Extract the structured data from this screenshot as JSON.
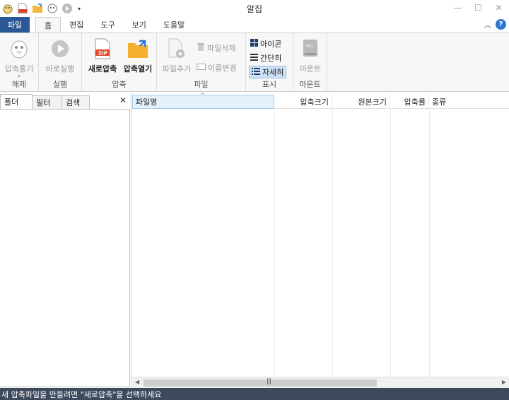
{
  "window": {
    "title": "알집"
  },
  "quick_access": [
    "app-logo-icon",
    "zip-icon",
    "folder-open-icon",
    "extract-icon",
    "play-icon",
    "dropdown-icon"
  ],
  "tabs": [
    {
      "label": "파일"
    },
    {
      "label": "홈"
    },
    {
      "label": "편집"
    },
    {
      "label": "도구"
    },
    {
      "label": "보기"
    },
    {
      "label": "도움말"
    }
  ],
  "ribbon": {
    "extract": {
      "label": "압축풀기",
      "group": "해제"
    },
    "run": {
      "label": "바로실행",
      "group": "실행"
    },
    "new_zip": {
      "label": "새로압축"
    },
    "open_zip": {
      "label": "압축열기"
    },
    "compress_group": "압축",
    "add_file": {
      "label": "파일추가"
    },
    "delete_file": {
      "label": "파일삭제"
    },
    "rename": {
      "label": "이름변경"
    },
    "file_group": "파일",
    "view_icon": {
      "label": "아이콘"
    },
    "view_simple": {
      "label": "간단히"
    },
    "view_detail": {
      "label": "자세히"
    },
    "display_group": "표시",
    "mount": {
      "label": "마운트",
      "group": "마운트",
      "badge": "ISO"
    }
  },
  "left_panel": {
    "tabs": [
      {
        "label": "폴더"
      },
      {
        "label": "필터"
      },
      {
        "label": "검색"
      }
    ],
    "close": "✕"
  },
  "file_list": {
    "columns": [
      {
        "label": "파일명"
      },
      {
        "label": "압축크기"
      },
      {
        "label": "원본크기"
      },
      {
        "label": "압축률"
      },
      {
        "label": "종류"
      }
    ],
    "rows": []
  },
  "status": {
    "text": "새 압축파일을 만들려면 \"새로압축\"을 선택하세요"
  },
  "colors": {
    "file_tab": "#2b5797",
    "status_bar": "#3d4a5c",
    "selected": "#cde0f5"
  }
}
